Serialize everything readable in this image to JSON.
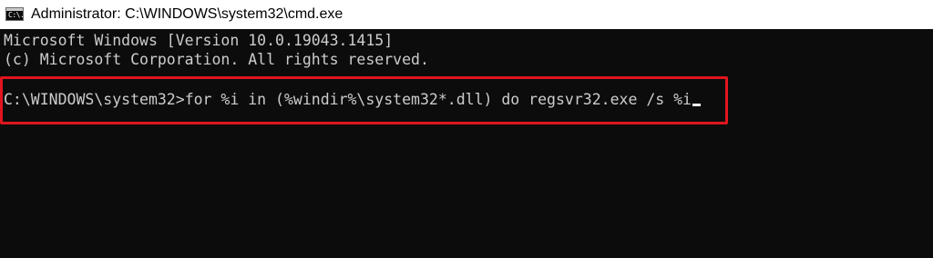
{
  "window": {
    "title": "Administrator: C:\\WINDOWS\\system32\\cmd.exe",
    "icon": "cmd-icon",
    "icon_glyph": "C:\\."
  },
  "console": {
    "lines": [
      "Microsoft Windows [Version 10.0.19043.1415]",
      "(c) Microsoft Corporation. All rights reserved."
    ],
    "prompt": "C:\\WINDOWS\\system32>",
    "command": "for %i in (%windir%\\system32*.dll) do regsvr32.exe /s %i"
  },
  "colors": {
    "background": "#0c0c0c",
    "text": "#cccccc",
    "highlight_border": "#e0151f"
  }
}
